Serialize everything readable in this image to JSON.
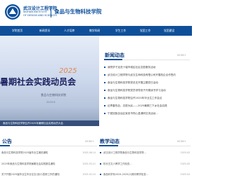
{
  "header": {
    "logo_cn": "武汉设计工程学院",
    "logo_en_line1": "WUHAN INSTITUTE",
    "logo_en_line2": "OF DESIGN AND SCIENCES",
    "college_name": "食品与生物科技学院"
  },
  "nav": {
    "items": [
      "学院首页",
      "新闻资讯",
      "人才培养",
      "教学科研",
      "学生工作",
      "党团工作",
      "党团建设"
    ]
  },
  "banner": {
    "year": "2025",
    "title": "暑期社会实践动员会",
    "subtitle": "食品与生物科技学院",
    "unit": "2025.6",
    "caption": "食品与生物科技学院召开2025年暑期社会实践动员大会"
  },
  "news": {
    "title": "新闻动态",
    "more": "MORE+",
    "items": [
      "我院学子走进十堰市城区社区志愿服务活动",
      "武汉设计工程学院与武汉生命科技有限公司开展校企合作签约",
      "食品与生物科技学院党总支开展主题党日活动",
      "食品与生物科技学院党员领导班子开展读书学习活动",
      "食品与生物科技学院召开2025年毕业生工作会议",
      "征青春热血，志愿为民——2025暑期三下乡社会实践",
      "宁夏回族自治区吴忠市同心县调研交流活动..."
    ]
  },
  "notice": {
    "title": "公告",
    "more": "MORE+",
    "items": [
      {
        "text": "食品与生物科技学院2025届毕业生离校通知",
        "date": "2025-06-14"
      },
      {
        "text": "2025年食品与生物科技学院暑期社会实践报名通知",
        "date": "2025-03-21"
      },
      {
        "text": "关于开展2025届毕业生毕业论文(设计)答辩工作的通知",
        "date": "2025-02-10"
      }
    ]
  },
  "teaching": {
    "title": "教学动态",
    "more": "MORE+",
    "items": [
      {
        "text": "武汉设计工程学院食品与生物科技学院...",
        "date": "2025-05"
      },
      {
        "text": "校长汪文人教学工作检查...",
        "date": "2025-05"
      },
      {
        "text": "食品科学系2024-2025(2)期中教学检查...",
        "date": "2025-04"
      }
    ]
  },
  "colors": {
    "brand": "#0f4f9a",
    "heading": "#0f3e82",
    "banner_accent": "#e7864a"
  }
}
